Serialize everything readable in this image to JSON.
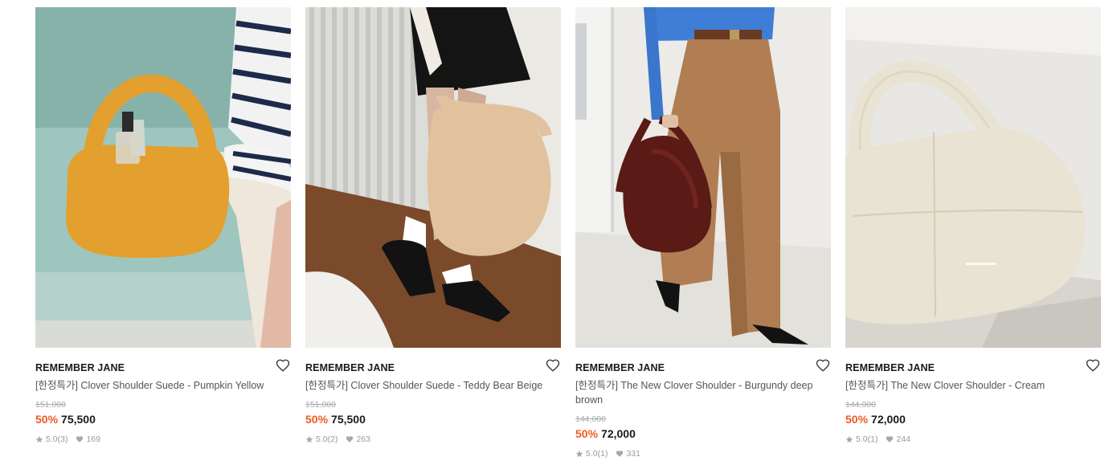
{
  "products": [
    {
      "brand": "REMEMBER JANE",
      "name": "[한정특가] Clover Shoulder Suede - Pumpkin Yellow",
      "original_price": "151,000",
      "discount": "50%",
      "price": "75,500",
      "rating": "5.0",
      "review_count": "(3)",
      "likes": "169",
      "bag_color": "#e3a02e"
    },
    {
      "brand": "REMEMBER JANE",
      "name": "[한정특가] Clover Shoulder Suede - Teddy Bear Beige",
      "original_price": "151,000",
      "discount": "50%",
      "price": "75,500",
      "rating": "5.0",
      "review_count": "(2)",
      "likes": "263",
      "bag_color": "#e2c29e"
    },
    {
      "brand": "REMEMBER JANE",
      "name": "[한정특가] The New Clover Shoulder - Burgundy deep brown",
      "original_price": "144,000",
      "discount": "50%",
      "price": "72,000",
      "rating": "5.0",
      "review_count": "(1)",
      "likes": "331",
      "bag_color": "#5a1a16"
    },
    {
      "brand": "REMEMBER JANE",
      "name": "[한정특가] The New Clover Shoulder - Cream",
      "original_price": "144,000",
      "discount": "50%",
      "price": "72,000",
      "rating": "5.0",
      "review_count": "(1)",
      "likes": "244",
      "bag_color": "#e8e3d2"
    }
  ],
  "colors": {
    "discount": "#f05a22",
    "brand_text": "#1a1a1a",
    "muted_text": "#9a9a9a"
  }
}
